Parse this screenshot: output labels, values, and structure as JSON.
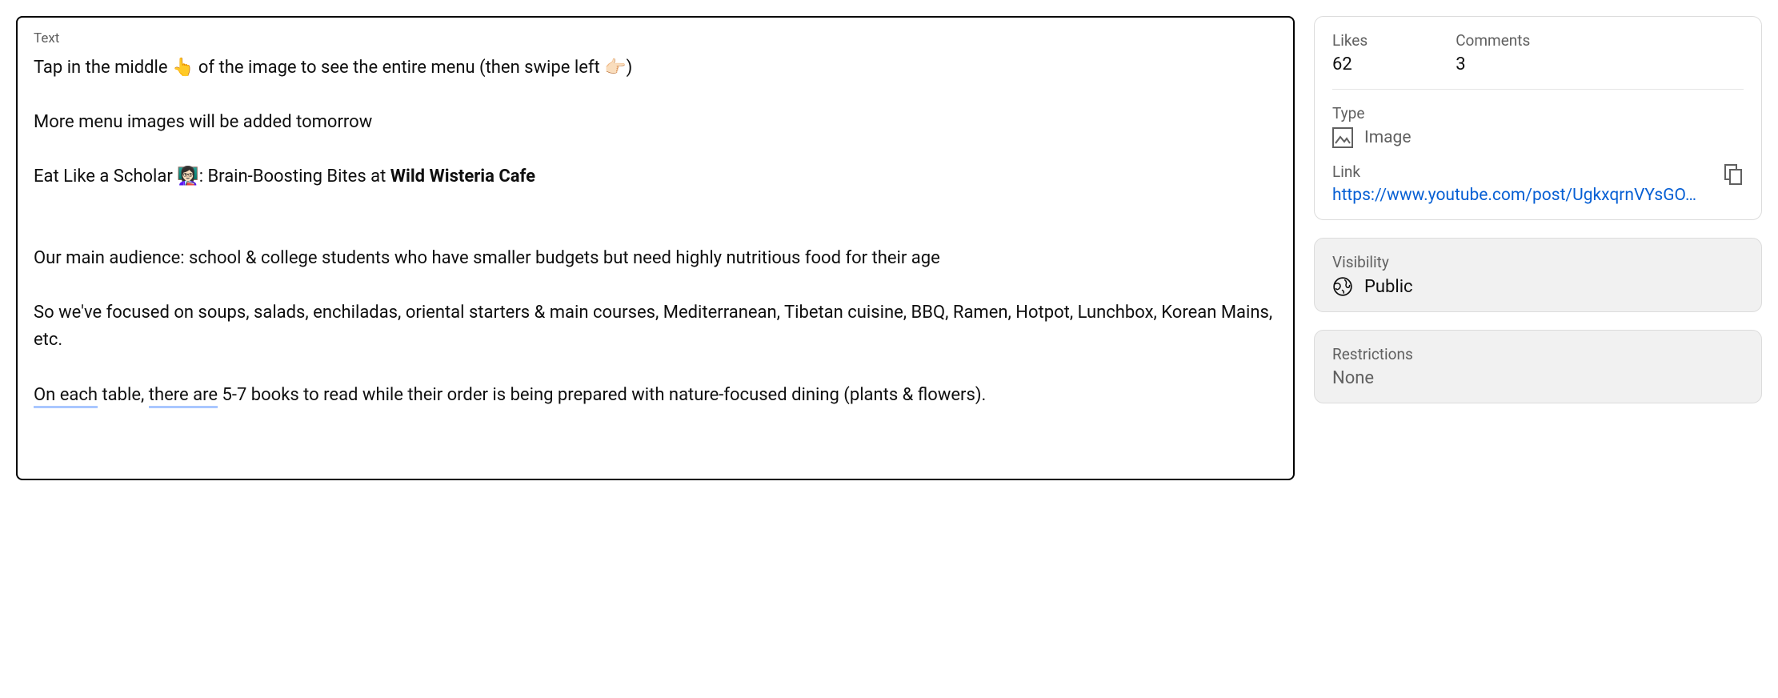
{
  "editor": {
    "field_label": "Text",
    "line1_a": "Tap in the middle ",
    "line1_emoji1": "👆",
    "line1_b": " of the image to see the entire menu (then swipe left ",
    "line1_emoji2": "👉🏻",
    "line1_c": ")",
    "line2": "More menu images will be added tomorrow",
    "line3_a": "Eat Like a Scholar ",
    "line3_emoji": "👩🏻‍🏫",
    "line3_b": ": Brain-Boosting Bites at ",
    "line3_bold": "Wild Wisteria Cafe",
    "line4": "Our main audience: school & college students who have smaller budgets but need highly nutritious food for their age",
    "line5": "So we've focused on soups, salads, enchiladas, oriental starters & main courses, Mediterranean, Tibetan cuisine, BBQ, Ramen, Hotpot, Lunchbox, Korean Mains, etc.",
    "line6_u1": "On each",
    "line6_mid1": " table, ",
    "line6_u2": "there are",
    "line6_rest": " 5-7 books to read while their order is being prepared with nature-focused dining (plants & flowers)."
  },
  "sidebar": {
    "likes_label": "Likes",
    "likes_value": "62",
    "comments_label": "Comments",
    "comments_value": "3",
    "type_label": "Type",
    "type_value": "Image",
    "link_label": "Link",
    "link_url": "https://www.youtube.com/post/UgkxqrnVYsGO…",
    "visibility_label": "Visibility",
    "visibility_value": "Public",
    "restrictions_label": "Restrictions",
    "restrictions_value": "None"
  }
}
